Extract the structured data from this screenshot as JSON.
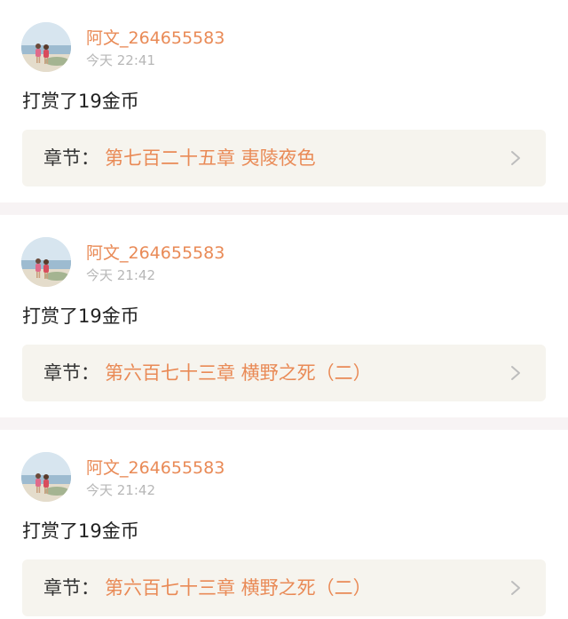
{
  "records": [
    {
      "username": "阿文_264655583",
      "time": "今天 22:41",
      "content": "打赏了19金币",
      "chapter_prefix": "章节：",
      "chapter_title": "第七百二十五章 夷陵夜色"
    },
    {
      "username": "阿文_264655583",
      "time": "今天 21:42",
      "content": "打赏了19金币",
      "chapter_prefix": "章节：",
      "chapter_title": "第六百七十三章 横野之死（二）"
    },
    {
      "username": "阿文_264655583",
      "time": "今天 21:42",
      "content": "打赏了19金币",
      "chapter_prefix": "章节：",
      "chapter_title": "第六百七十三章 横野之死（二）"
    }
  ],
  "colors": {
    "accent": "#e98a56",
    "text": "#222222",
    "muted": "#b7b7b7",
    "chapter_bg": "#f6f4ee",
    "separator": "#f7f3f4"
  },
  "icons": {
    "avatar": "avatar-photo-beach-children",
    "chevron": "chevron-right-icon"
  }
}
